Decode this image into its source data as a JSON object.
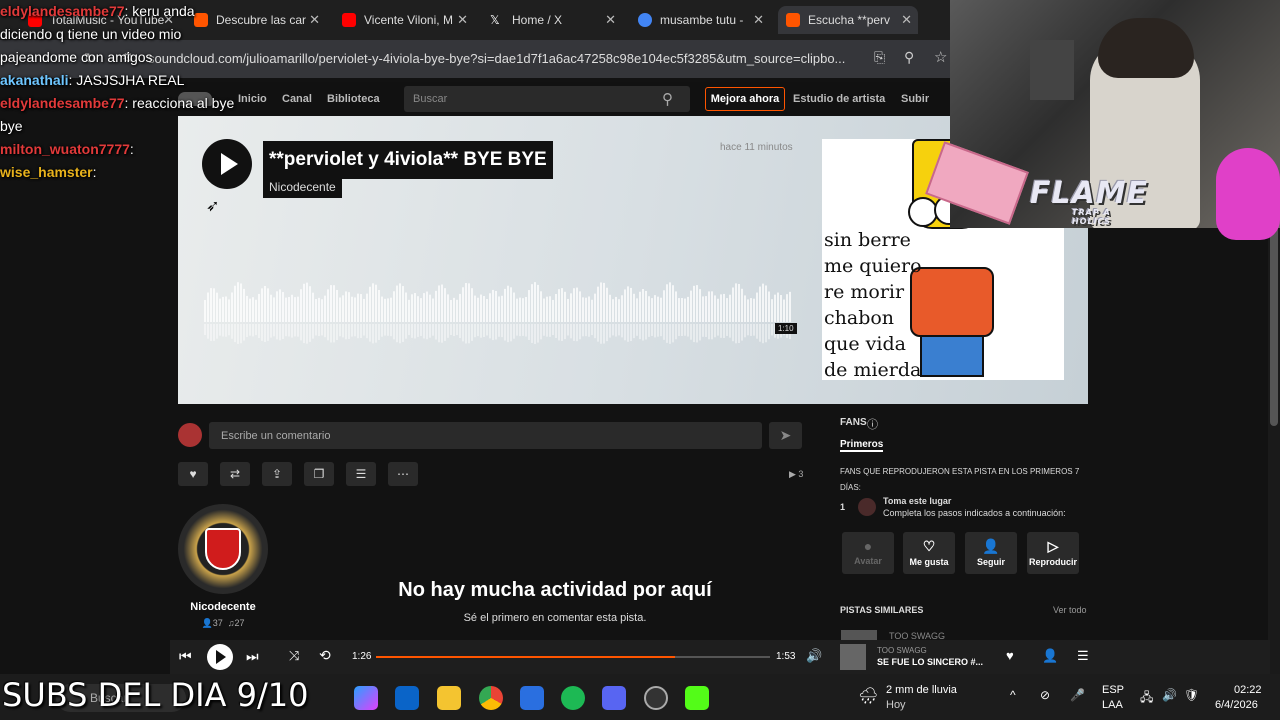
{
  "browser": {
    "tabs": [
      {
        "label": "TotalMusic - YouTube",
        "icon": "youtube-icon",
        "color": "#ff0000"
      },
      {
        "label": "Descubre las car",
        "icon": "soundcloud-icon",
        "color": "#ff5500"
      },
      {
        "label": "Vicente Viloni, M",
        "icon": "youtube-icon",
        "color": "#ff0000"
      },
      {
        "label": "Home / X",
        "icon": "x-icon",
        "color": "#ffffff"
      },
      {
        "label": "musambe tutu -",
        "icon": "google-icon",
        "color": "#4285f4"
      },
      {
        "label": "Escucha **perv",
        "icon": "soundcloud-icon",
        "color": "#ff5500"
      }
    ],
    "url": "soundcloud.com/julioamarillo/perviolet-y-4iviola-bye-bye?si=dae1d7f1a6ac47258c98e104ec5f3285&utm_source=clipbo..."
  },
  "soundcloud": {
    "nav": {
      "home": "Inicio",
      "feed": "Canal",
      "library": "Biblioteca",
      "upgrade": "Mejora ahora",
      "artist_studio": "Estudio de artista",
      "upload": "Subir"
    },
    "search_placeholder": "Buscar",
    "track": {
      "title": "**perviolet y 4iviola** BYE BYE",
      "artist": "Nicodecente",
      "posted": "hace 11 minutos",
      "duration": "1:10",
      "artwork_text": "sin berre\nme quiero\nre morir\nchabon\nque vida\nde mierda"
    },
    "comment_placeholder": "Escribe un comentario",
    "play_count": "3",
    "uploader": {
      "name": "Nicodecente",
      "followers": "37",
      "tracks": "27"
    },
    "empty": {
      "title": "No hay mucha actividad por aquí",
      "subtitle": "Sé el primero en comentar esta pista."
    },
    "sidebar": {
      "fans_title": "FANS",
      "tab_first": "Primeros",
      "fans_desc": "FANS QUE REPRODUJERON ESTA PISTA EN LOS PRIMEROS 7 DÍAS:",
      "rank": "1",
      "claim_title": "Toma este lugar",
      "claim_desc": "Completa los pasos indicados a continuación:",
      "steps": [
        "Avatar",
        "Me gusta",
        "Seguir",
        "Reproducir"
      ],
      "similar_title": "PISTAS SIMILARES",
      "see_all": "Ver todo",
      "similar_first": "TOO SWAGG"
    },
    "player": {
      "current_time": "1:26",
      "total_time": "1:53",
      "progress": 0.76,
      "now_artist": "TOO SWAGG",
      "now_title": "SE FUE LO SINCERO #..."
    }
  },
  "overlay": {
    "chat": [
      {
        "user": "eldylandesambe77",
        "msg": ": keru anda",
        "color": "#e23a3a"
      },
      {
        "user": "",
        "msg": "diciendo q tiene un video mio",
        "color": "#ffffff"
      },
      {
        "user": "",
        "msg": "pajeandome con amigos",
        "color": "#ffffff"
      },
      {
        "user": "akanathali",
        "msg": ": JASJSJHA REAL",
        "color": "#6ec6ff"
      },
      {
        "user": "eldylandesambe77",
        "msg": ": reacciona al bye",
        "color": "#e23a3a"
      },
      {
        "user": "",
        "msg": "bye",
        "color": "#ffffff"
      },
      {
        "user": "milton_wuaton7777",
        "msg": ":",
        "color": "#e23a3a"
      },
      {
        "user": "wise_hamster",
        "msg": ":",
        "color": "#e8b21c"
      }
    ],
    "flame": "FLAME",
    "flame_sub": "TRAP A HOLICS",
    "subs_banner": "SUBS DEL DIA 9/10"
  },
  "taskbar": {
    "search": "Buscar",
    "weather": "2 mm de lluvia",
    "weather_sub": "Hoy",
    "lang": "ESP",
    "lang_sub": "LAA",
    "time": "02:22",
    "date": "6/4/2026"
  }
}
